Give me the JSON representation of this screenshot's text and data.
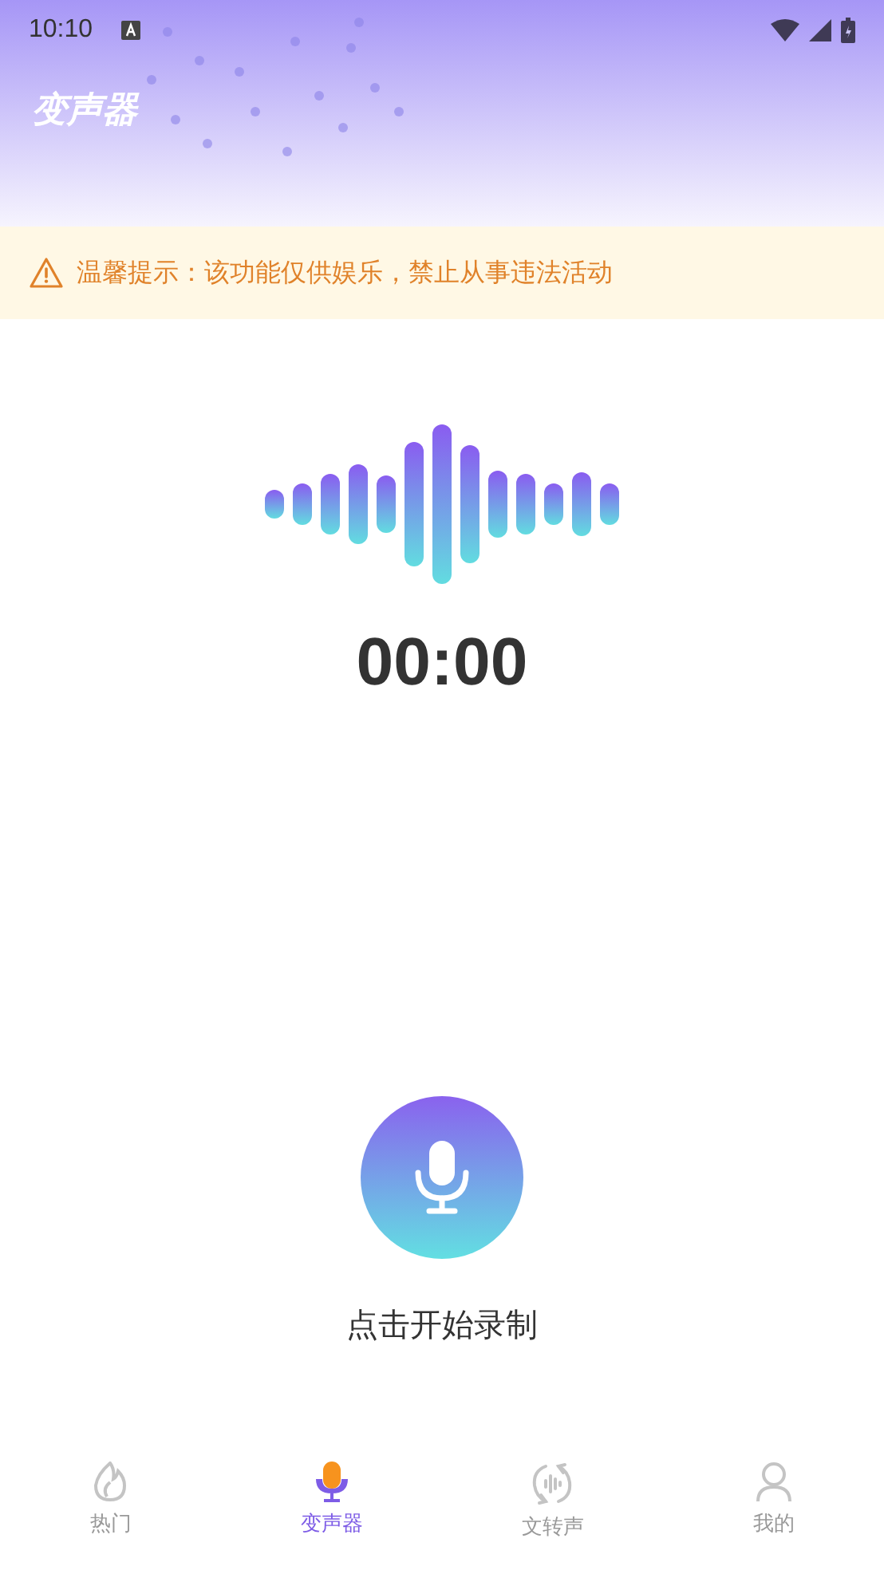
{
  "status_bar": {
    "time": "10:10"
  },
  "header": {
    "title": "变声器"
  },
  "notice": {
    "text": "温馨提示：该功能仅供娱乐，禁止从事违法活动"
  },
  "recorder": {
    "timer": "00:00",
    "prompt": "点击开始录制"
  },
  "tabs": [
    {
      "label": "热门",
      "kind": "flame",
      "selected": false
    },
    {
      "label": "变声器",
      "kind": "mic",
      "selected": true
    },
    {
      "label": "文转声",
      "kind": "convert",
      "selected": false
    },
    {
      "label": "我的",
      "kind": "person",
      "selected": false
    }
  ]
}
